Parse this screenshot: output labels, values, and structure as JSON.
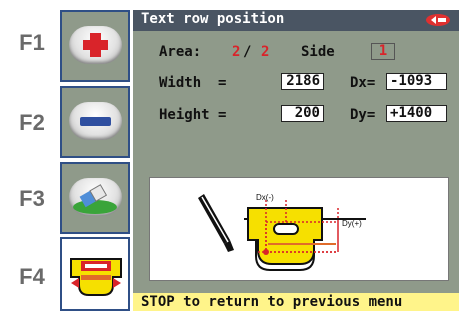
{
  "function_keys": {
    "f1": "F1",
    "f2": "F2",
    "f3": "F3",
    "f4": "F4"
  },
  "title": "Text row position",
  "area": {
    "label": "Area:",
    "current": "2",
    "separator": "/",
    "total": "2"
  },
  "side": {
    "label": "Side",
    "value": "1"
  },
  "width": {
    "label": "Width  =",
    "value": "2186"
  },
  "height": {
    "label": "Height =",
    "value": "200"
  },
  "dx": {
    "label": "Dx=",
    "value": "-1093"
  },
  "dy": {
    "label": "Dy=",
    "value": "+1400"
  },
  "diagram": {
    "dx_label": "Dx(-)",
    "dy_label": "Dy(+)"
  },
  "status_text": "STOP to return to previous menu",
  "colors": {
    "panel_bg": "#8f9a8a",
    "title_bar": "#4a5563",
    "accent_red": "#d9242a",
    "key_yellow": "#f6e000",
    "status_bg": "#fff48a"
  },
  "icons": [
    "plus-icon",
    "minus-icon",
    "eraser-icon",
    "key-position-icon",
    "brand-logo-icon"
  ]
}
